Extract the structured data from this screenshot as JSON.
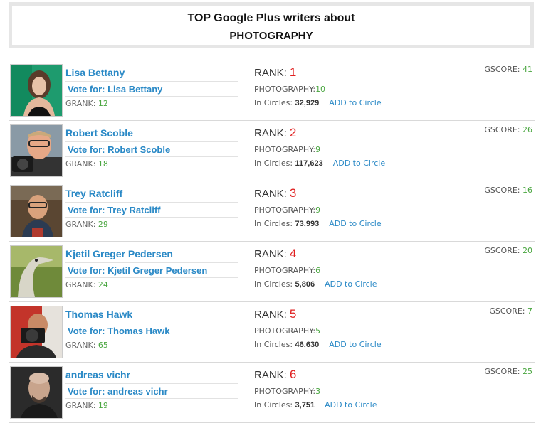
{
  "header": {
    "title_line1": "TOP Google Plus writers about",
    "title_line2": "PHOTOGRAPHY"
  },
  "labels": {
    "rank": "RANK:",
    "category": "PHOTOGRAPHY:",
    "in_circles": "In Circles:",
    "add_to_circle": "ADD to Circle",
    "gscore": "GSCORE:",
    "grank": "GRANK:"
  },
  "colors": {
    "link_blue": "#2a89c6",
    "rank_red": "#e02020",
    "score_green": "#4aa640"
  },
  "writers": [
    {
      "name": "Lisa Bettany",
      "vote": "Vote for: Lisa Bettany",
      "grank": "12",
      "rank": "1",
      "category_score": "10",
      "circles": "32,929",
      "gscore": "41"
    },
    {
      "name": "Robert Scoble",
      "vote": "Vote for: Robert Scoble",
      "grank": "18",
      "rank": "2",
      "category_score": "9",
      "circles": "117,623",
      "gscore": "26"
    },
    {
      "name": "Trey Ratcliff",
      "vote": "Vote for: Trey Ratcliff",
      "grank": "29",
      "rank": "3",
      "category_score": "9",
      "circles": "73,993",
      "gscore": "16"
    },
    {
      "name": "Kjetil Greger Pedersen",
      "vote": "Vote for: Kjetil Greger Pedersen",
      "grank": "24",
      "rank": "4",
      "category_score": "6",
      "circles": "5,806",
      "gscore": "20"
    },
    {
      "name": "Thomas Hawk",
      "vote": "Vote for: Thomas Hawk",
      "grank": "65",
      "rank": "5",
      "category_score": "5",
      "circles": "46,630",
      "gscore": "7"
    },
    {
      "name": "andreas vichr",
      "vote": "Vote for: andreas vichr",
      "grank": "19",
      "rank": "6",
      "category_score": "3",
      "circles": "3,751",
      "gscore": "25"
    }
  ]
}
